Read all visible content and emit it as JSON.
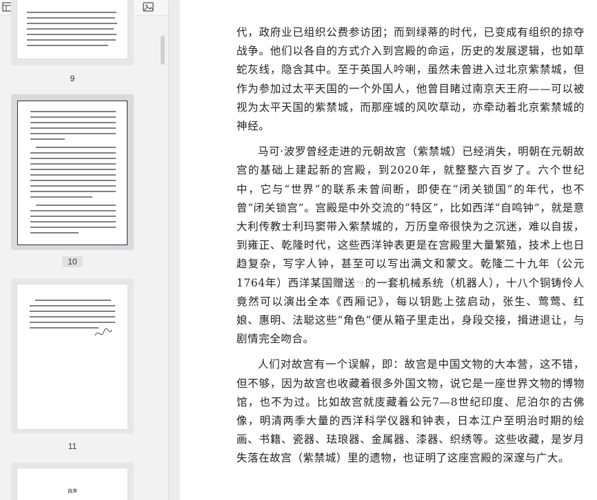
{
  "sidebar": {
    "thumbnails": [
      {
        "page": "9"
      },
      {
        "page": "10",
        "selected": true
      },
      {
        "page": "11"
      },
      {
        "page": "",
        "title": "自序"
      }
    ]
  },
  "document": {
    "paragraphs": [
      "代，政府业已组织公费参访团；而到绿蒂的时代，已变成有组织的掠夺战争。他们以各自的方式介入到宫殿的命运，历史的发展逻辑，也如草蛇灰线，隐含其中。至于英国人吟唎，虽然未曾进入过北京紫禁城，但作为参加过太平天国的一个外国人，他曾目睹过南京天王府——可以被视为太平天国的紫禁城，而那座城的风吹草动，亦牵动着北京紫禁城的神经。",
      "马可·波罗曾经走进的元朝故宫（紫禁城）已经消失，明朝在元朝故宫的基础上建起新的宫殿，到2020年，就整整六百岁了。六个世纪中，它与“世界”的联系未曾间断，即使在“闭关锁国”的年代，也不曾“闭关锁宫”。宫殿是中外交流的“特区”，比如西洋“自鸣钟”，就是意大利传教士利玛窦带入紫禁城的，万历皇帝很快为之沉迷，难以自拔，到雍正、乾隆时代，这些西洋钟表更是在宫殿里大量繁殖，技术上也日趋复杂，写字人钟，甚至可以写出满文和蒙文。乾隆二十九年（公元1764年）西洋某国赠送",
      "的一套机械系统（机器人），十八个铜铸伶人竟然可以演出全本《西厢记》，每以钥匙上弦启动，张生、莺莺、红娘、惠明、法聪这些“角色”便从箱子里走出，身段交接，揖进退让，与剧情完全吻合。",
      "人们对故宫有一个误解，即：故宫是中国文物的大本营，这不错，但不够，因为故宫也收藏着很多外国文物，说它是一座世界文物的博物馆，也不为过。比如故宫就庋藏着公元7—8世纪印度、尼泊尔的古佛像，明清两季大量的西洋科学仪器和钟表，日本江户至明治时期的绘画、书籍、瓷器、珐琅器、金属器、漆器、织绣等。这些收藏，是岁月失落在故宫（紫禁城）里的遗物，也证明了这座宫殿的深邃与广大。"
    ]
  }
}
